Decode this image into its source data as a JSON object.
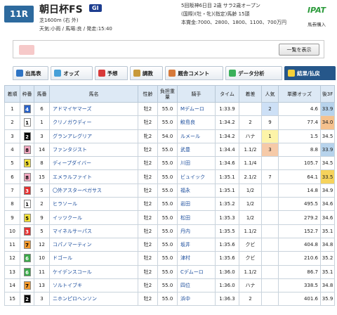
{
  "header": {
    "race_no": "11R",
    "race_name": "朝日杯FS",
    "grade": "GI",
    "course": "芝1600m (右 外)",
    "weather": "天気:小雨 / 馬場:良 / 発走:15:40",
    "info_line1": "5回阪神6日目  2歳  サラ2歳オープン",
    "info_line2": "(国際)(牡・牝)(指定)馬齢  15頭",
    "info_line3": "本賞金:7000、2800、1800、1100、700万円",
    "ipat_label": "IPAT",
    "ipat_sub": "馬券購入"
  },
  "search": {
    "button_label": "一覧を表示"
  },
  "tabs": [
    {
      "label": "出馬表",
      "icon": "list-icon",
      "color": "#2e74c4"
    },
    {
      "label": "オッズ",
      "icon": "odds-icon",
      "color": "#46a0d8"
    },
    {
      "label": "予想",
      "icon": "target-icon",
      "color": "#d83a3a"
    },
    {
      "label": "調教",
      "icon": "horse-icon",
      "color": "#c89a3a"
    },
    {
      "label": "厩舎コメント",
      "icon": "comment-icon",
      "color": "#d6793a"
    },
    {
      "label": "データ分析",
      "icon": "chart-icon",
      "color": "#3ab05a"
    },
    {
      "label": "結果/払戻",
      "icon": "result-icon",
      "color": "#f5d13a"
    }
  ],
  "table": {
    "headers": [
      "着順",
      "枠番",
      "馬番",
      "馬名",
      "性齢",
      "負担重量",
      "騎手",
      "タイム",
      "着差",
      "人気",
      "単勝オッズ",
      "後3F"
    ],
    "rows": [
      {
        "rank": "1",
        "waku": "4",
        "uma": "6",
        "name": "アドマイヤマーズ",
        "sex": "牡2",
        "weight": "55.0",
        "jockey": "Mデムーロ",
        "time": "1:33.9",
        "diff": "",
        "pop": "2",
        "odds": "4.6",
        "f3": "33.9"
      },
      {
        "rank": "2",
        "waku": "1",
        "uma": "1",
        "name": "クリノガウディー",
        "sex": "牡2",
        "weight": "55.0",
        "jockey": "鮫島良",
        "time": "1:34.2",
        "diff": "2",
        "pop": "9",
        "odds": "77.4",
        "f3": "34.0"
      },
      {
        "rank": "3",
        "waku": "2",
        "uma": "3",
        "name": "グランアレグリア",
        "sex": "牝2",
        "weight": "54.0",
        "jockey": "ルメール",
        "time": "1:34.2",
        "diff": "ハナ",
        "pop": "1",
        "odds": "1.5",
        "f3": "34.5"
      },
      {
        "rank": "4",
        "waku": "8",
        "uma": "14",
        "name": "ファンタジスト",
        "sex": "牡2",
        "weight": "55.0",
        "jockey": "武豊",
        "time": "1:34.4",
        "diff": "1.1/2",
        "pop": "3",
        "odds": "8.8",
        "f3": "33.9"
      },
      {
        "rank": "5",
        "waku": "5",
        "uma": "8",
        "name": "ディープダイバー",
        "sex": "牡2",
        "weight": "55.0",
        "jockey": "川田",
        "time": "1:34.6",
        "diff": "1.1/4",
        "pop": "",
        "odds": "105.7",
        "f3": "34.5"
      },
      {
        "rank": "6",
        "waku": "8",
        "uma": "15",
        "name": "エメラルファイト",
        "sex": "牡2",
        "weight": "55.0",
        "jockey": "ビュイック",
        "time": "1:35.1",
        "diff": "2.1/2",
        "pop": "7",
        "odds": "64.1",
        "f3": "33.5"
      },
      {
        "rank": "7",
        "waku": "3",
        "uma": "5",
        "name": "〇外アスターペガサス",
        "sex": "牡2",
        "weight": "55.0",
        "jockey": "福永",
        "time": "1:35.1",
        "diff": "1/2",
        "pop": "",
        "odds": "14.8",
        "f3": "34.9"
      },
      {
        "rank": "8",
        "waku": "1",
        "uma": "2",
        "name": "ヒラソール",
        "sex": "牡2",
        "weight": "55.0",
        "jockey": "岩田",
        "time": "1:35.2",
        "diff": "1/2",
        "pop": "",
        "odds": "495.5",
        "f3": "34.6"
      },
      {
        "rank": "9",
        "waku": "5",
        "uma": "9",
        "name": "イッツクール",
        "sex": "牡2",
        "weight": "55.0",
        "jockey": "松田",
        "time": "1:35.3",
        "diff": "1/2",
        "pop": "",
        "odds": "279.2",
        "f3": "34.6"
      },
      {
        "rank": "10",
        "waku": "3",
        "uma": "5",
        "name": "マイネルサーパス",
        "sex": "牡2",
        "weight": "55.0",
        "jockey": "丹内",
        "time": "1:35.5",
        "diff": "1.1/2",
        "pop": "",
        "odds": "152.7",
        "f3": "35.1"
      },
      {
        "rank": "11",
        "waku": "7",
        "uma": "12",
        "name": "コパノマーティン",
        "sex": "牡2",
        "weight": "55.0",
        "jockey": "坂井",
        "time": "1:35.6",
        "diff": "クビ",
        "pop": "",
        "odds": "404.8",
        "f3": "34.8"
      },
      {
        "rank": "12",
        "waku": "6",
        "uma": "10",
        "name": "ドゴール",
        "sex": "牡2",
        "weight": "55.0",
        "jockey": "津村",
        "time": "1:35.6",
        "diff": "クビ",
        "pop": "",
        "odds": "210.6",
        "f3": "35.2"
      },
      {
        "rank": "13",
        "waku": "6",
        "uma": "11",
        "name": "ケイデンスコール",
        "sex": "牡2",
        "weight": "55.0",
        "jockey": "Cデムーロ",
        "time": "1:36.0",
        "diff": "1.1/2",
        "pop": "",
        "odds": "86.7",
        "f3": "35.1"
      },
      {
        "rank": "14",
        "waku": "7",
        "uma": "13",
        "name": "ソルトイブキ",
        "sex": "牡2",
        "weight": "55.0",
        "jockey": "四位",
        "time": "1:36.0",
        "diff": "ハナ",
        "pop": "",
        "odds": "338.5",
        "f3": "34.8"
      },
      {
        "rank": "15",
        "waku": "2",
        "uma": "3",
        "name": "ニホンピロヘンソン",
        "sex": "牡2",
        "weight": "55.0",
        "jockey": "浜中",
        "time": "1:36.3",
        "diff": "2",
        "pop": "",
        "odds": "401.6",
        "f3": "35.9"
      }
    ]
  }
}
